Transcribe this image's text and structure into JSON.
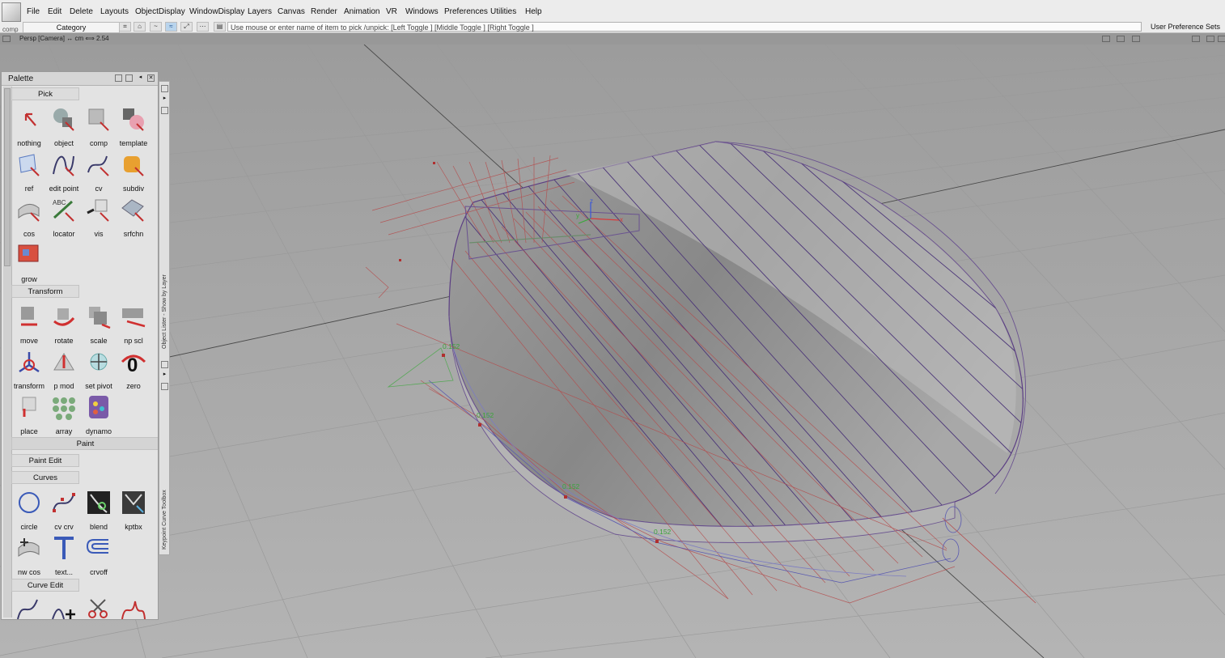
{
  "menu": [
    "File",
    "Edit",
    "Delete",
    "Layouts",
    "ObjectDisplay",
    "WindowDisplay",
    "Layers",
    "Canvas",
    "Render",
    "Animation",
    "VR",
    "Windows",
    "Preferences",
    "Utilities",
    "Help"
  ],
  "app": {
    "label": "comp"
  },
  "toolbar": {
    "category": "Category",
    "pick_prompt": "Use mouse or enter name of item to pick /unpick:  [Left Toggle ]  [Middle Toggle ]  [Right Toggle ]",
    "user_pref": "User Preference Sets"
  },
  "viewport": {
    "camera_label": "Persp [Camera]  ↔ cm    ⟺ 2.54",
    "annotations": [
      "0.152",
      "0.152",
      "0.152",
      "0.152"
    ],
    "axes": {
      "x": "x",
      "y": "y",
      "z": "z"
    }
  },
  "palette": {
    "title": "Palette",
    "sections": {
      "pick": "Pick",
      "transform": "Transform",
      "paint": "Paint",
      "paint_edit": "Paint Edit",
      "curves": "Curves",
      "curve_edit": "Curve Edit"
    },
    "pick_tools": [
      "nothing",
      "object",
      "comp",
      "template",
      "ref",
      "edit point",
      "cv",
      "subdiv",
      "cos",
      "locator",
      "vis",
      "srfchn",
      "grow"
    ],
    "transform_tools": [
      "move",
      "rotate",
      "scale",
      "np scl",
      "transform",
      "p mod",
      "set pivot",
      "zero",
      "place",
      "array",
      "dynamo"
    ],
    "curve_tools": [
      "circle",
      "cv crv",
      "blend",
      "kptbx",
      "nw cos",
      "text...",
      "crvoff"
    ]
  },
  "side_strip": {
    "object_lister": "Object Lister - Show by Layer",
    "keypoint_toolbox": "Keypoint Curve Toolbox"
  }
}
